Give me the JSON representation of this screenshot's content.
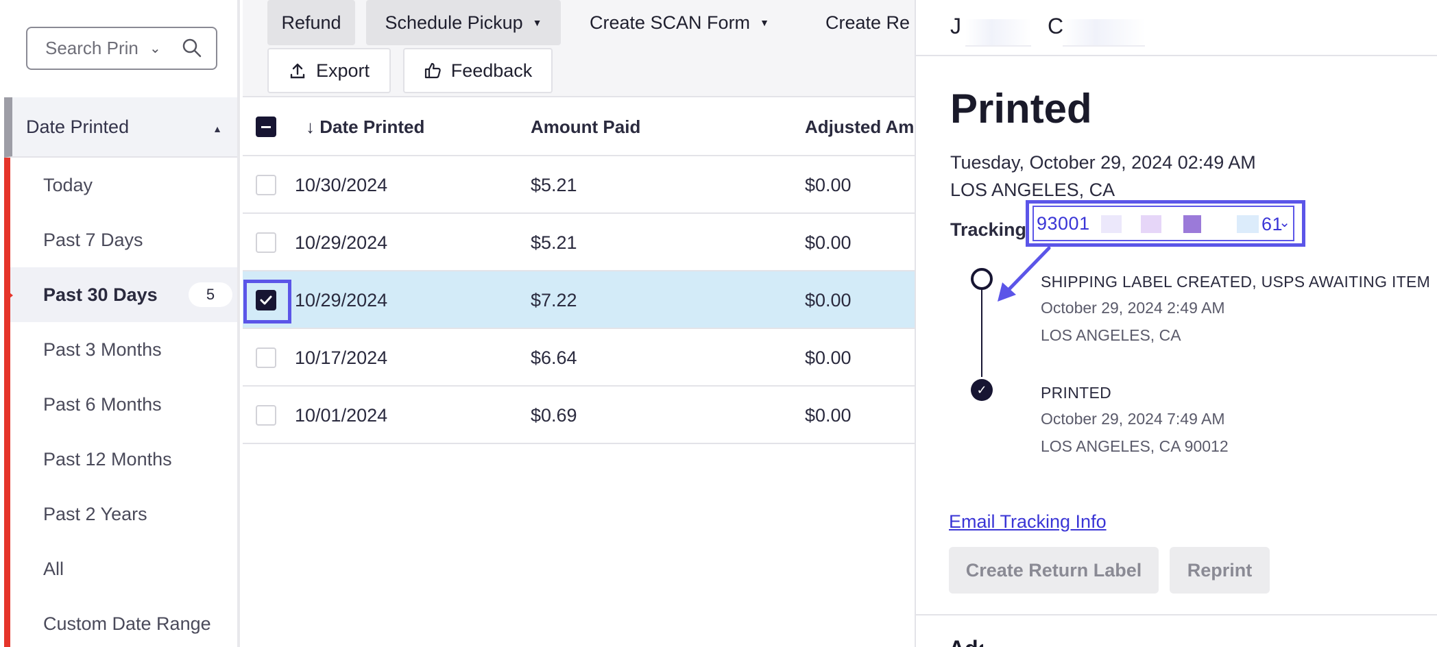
{
  "sidebar": {
    "search_placeholder": "Search Prin",
    "filter_header": "Date Printed",
    "items": [
      {
        "label": "Today"
      },
      {
        "label": "Past 7 Days"
      },
      {
        "label": "Past 30 Days",
        "count": "5",
        "active": true
      },
      {
        "label": "Past 3 Months"
      },
      {
        "label": "Past 6 Months"
      },
      {
        "label": "Past 12 Months"
      },
      {
        "label": "Past 2 Years"
      },
      {
        "label": "All"
      },
      {
        "label": "Custom Date Range"
      }
    ]
  },
  "toolbar": {
    "refund": "Refund",
    "schedule_pickup": "Schedule Pickup",
    "create_scan_form": "Create SCAN Form",
    "create_return": "Create Re",
    "export": "Export",
    "feedback": "Feedback"
  },
  "table": {
    "columns": [
      "Date Printed",
      "Amount Paid",
      "Adjusted Am"
    ],
    "rows": [
      {
        "date": "10/30/2024",
        "amount": "$5.21",
        "adjusted": "$0.00",
        "checked": false
      },
      {
        "date": "10/29/2024",
        "amount": "$5.21",
        "adjusted": "$0.00",
        "checked": false
      },
      {
        "date": "10/29/2024",
        "amount": "$7.22",
        "adjusted": "$0.00",
        "checked": true
      },
      {
        "date": "10/17/2024",
        "amount": "$6.64",
        "adjusted": "$0.00",
        "checked": false
      },
      {
        "date": "10/01/2024",
        "amount": "$0.69",
        "adjusted": "$0.00",
        "checked": false
      }
    ]
  },
  "panel": {
    "name_first_initial": "J",
    "name_last_initial": "C",
    "status": "Printed",
    "date": "Tuesday, October 29, 2024 02:49 AM",
    "location": "LOS ANGELES, CA",
    "tracking_label": "Tracking",
    "tracking_prefix": "93001",
    "tracking_suffix": "61",
    "events": [
      {
        "title": "SHIPPING LABEL CREATED, USPS AWAITING ITEM",
        "time": "October 29, 2024 2:49 AM",
        "place": "LOS ANGELES, CA"
      },
      {
        "title": "PRINTED",
        "time": "October 29, 2024 7:49 AM",
        "place": "LOS ANGELES, CA 90012"
      }
    ],
    "email_link": "Email Tracking Info",
    "create_return_label": "Create Return Label",
    "reprint": "Reprint",
    "next_heading": "Add"
  },
  "colors": {
    "accent": "#5b55e8",
    "link": "#3a35d6",
    "brand_red": "#e5352b",
    "selected_row": "#d3ebf8",
    "dark": "#171532"
  },
  "icons": [
    "search-icon",
    "chevron-down-icon",
    "caret-up-icon",
    "upload-icon",
    "thumbs-up-icon",
    "arrow-down-icon",
    "check-icon",
    "circle-icon"
  ]
}
